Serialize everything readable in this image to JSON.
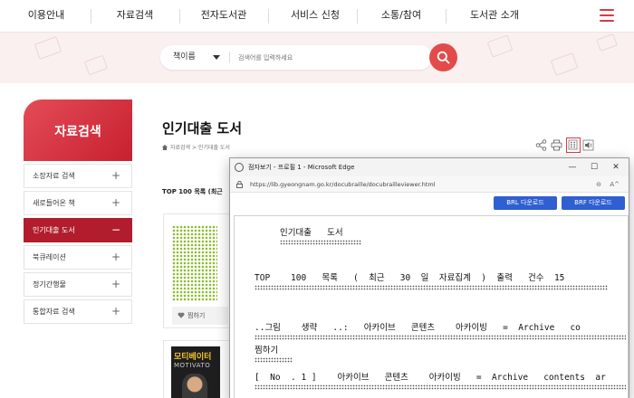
{
  "nav": {
    "items": [
      "이용안내",
      "자료검색",
      "전자도서관",
      "서비스 신청",
      "소통/참여",
      "도서관 소개"
    ]
  },
  "search": {
    "scope": "책이름",
    "placeholder": "검색어를 입력하세요"
  },
  "sidebar": {
    "title": "자료검색",
    "items": [
      {
        "label": "소장자료 검색",
        "marker": "+"
      },
      {
        "label": "새로들어온 책",
        "marker": "+"
      },
      {
        "label": "인기대출 도서",
        "marker": "−"
      },
      {
        "label": "북큐레이션",
        "marker": "+"
      },
      {
        "label": "정기간행물",
        "marker": "+"
      },
      {
        "label": "통합자료 검색",
        "marker": "+"
      }
    ]
  },
  "content": {
    "title": "인기대출 도서",
    "breadcrumb": "자료검색 > 인기대출 도서",
    "top_list_label": "TOP 100 목록 (최근",
    "like_label": "찜하기",
    "cover2_title": "모티베이터",
    "cover2_sub": "MOTIVATO"
  },
  "popup": {
    "title": "점자보기 - 프로필 1 - Microsoft Edge",
    "url": "https://lib.gyeongnam.go.kr/docubraille/docubrailleviewer.html",
    "controls": {
      "min": "—",
      "max": "☐",
      "close": "✕"
    },
    "addr_icons": {
      "zoom": "⊖",
      "read": "A^"
    },
    "btn_brl": "BRL 다운로드",
    "btn_brf": "BRF 다운로드",
    "lines": [
      "인기대출   도서",
      "TOP    100   목록   (  최근   30  일  자료집계  )  출력   건수  15",
      "..그림    생략   ..:   아카이브   콘텐츠    아카이빙   =  Archive   co",
      "찜하기",
      "[  No  . 1 ]    아카이브   콘텐츠    아카이빙   =  Archive   contents  ar"
    ]
  },
  "colors": {
    "accent": "#d63a4a",
    "sidebar_active": "#b11d2c",
    "edge_blue": "#2f5fd0",
    "banner_bg": "#faf0ef"
  }
}
